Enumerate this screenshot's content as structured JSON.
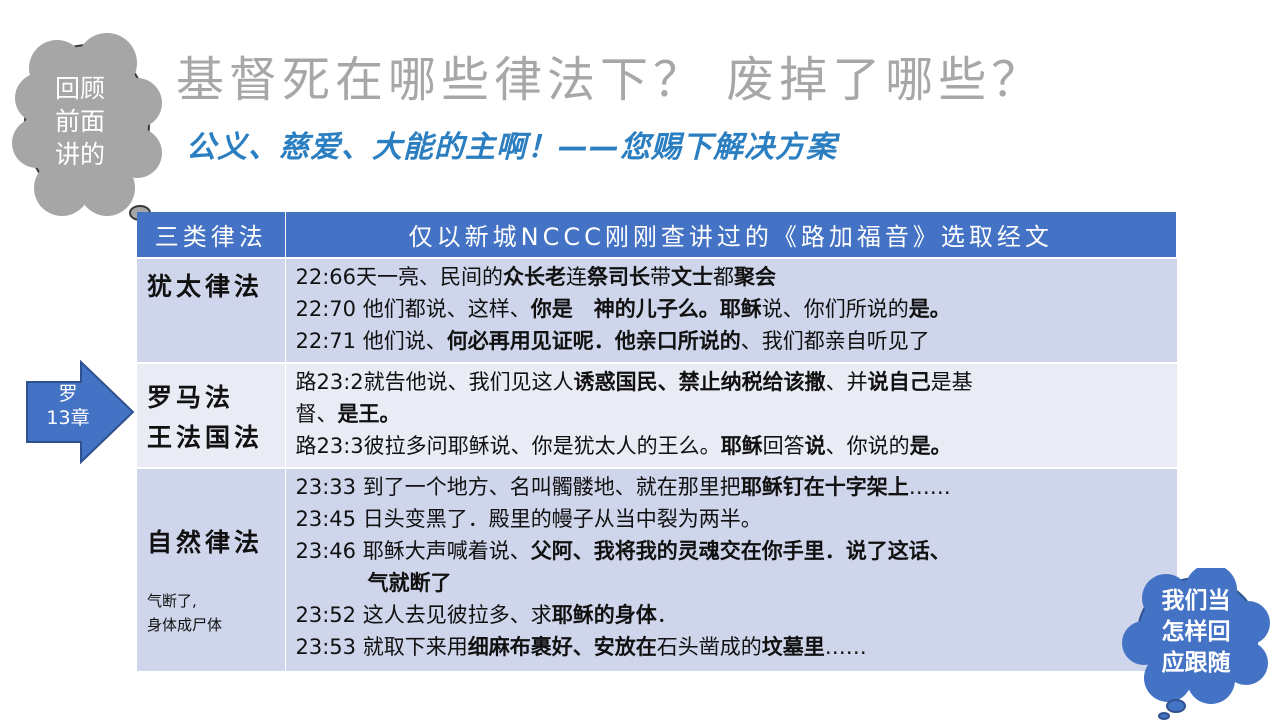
{
  "left_cloud": {
    "lines": [
      "回顾",
      "前面",
      "讲的"
    ]
  },
  "title": "基督死在哪些律法下？ 废掉了哪些？",
  "subtitle": "公义、慈爱、大能的主啊！——您赐下解决方案",
  "table": {
    "headers": [
      "三类律法",
      "仅以新城NCCC刚刚查讲过的《路加福音》选取经文"
    ],
    "rows": [
      {
        "category_lines": [
          "犹太律法"
        ],
        "note_lines": [],
        "verses": [
          [
            [
              "22:66天一亮、民间的",
              false
            ],
            [
              "众长老",
              true
            ],
            [
              "连",
              false
            ],
            [
              "祭司长",
              true
            ],
            [
              "带",
              false
            ],
            [
              "文士",
              true
            ],
            [
              "都",
              false
            ],
            [
              "聚会",
              true
            ]
          ],
          [
            [
              "22:70 他们都说、这样、",
              false
            ],
            [
              "你是　神的儿子么。耶稣",
              true
            ],
            [
              "说、你们所说的",
              false
            ],
            [
              "是。",
              true
            ]
          ],
          [
            [
              "22:71 他们说、",
              false
            ],
            [
              "何必再用见证呢．他亲口所说的",
              true
            ],
            [
              "、我们都亲自听见了",
              false
            ]
          ]
        ]
      },
      {
        "category_lines": [
          "罗马法",
          "王法国法"
        ],
        "note_lines": [],
        "verses": [
          [
            [
              "路23:2就告他说、我们见这人",
              false
            ],
            [
              "诱惑国民、禁止纳税给该撒",
              true
            ],
            [
              "、并",
              false
            ],
            [
              "说自己",
              true
            ],
            [
              "是基",
              false
            ]
          ],
          [
            [
              "督、",
              false
            ],
            [
              "是王。",
              true
            ]
          ],
          [
            [
              "路23:3彼拉多问耶稣说、你是犹太人的王么。",
              false
            ],
            [
              "耶稣",
              true
            ],
            [
              "回答",
              false
            ],
            [
              "说",
              true
            ],
            [
              "、你说的",
              false
            ],
            [
              "是。",
              true
            ]
          ]
        ]
      },
      {
        "category_lines": [
          "自然律法"
        ],
        "note_lines": [
          "气断了,",
          "身体成尸体"
        ],
        "verses": [
          [
            [
              "23:33 到了一个地方、名叫髑髅地、就在那里把",
              false
            ],
            [
              "耶稣钉在十字架上",
              true
            ],
            [
              "……",
              false
            ]
          ],
          [
            [
              "23:45 日头变黑了．殿里的幔子从当中裂为两半。",
              false
            ]
          ],
          [
            [
              "23:46 耶稣大声喊着说、",
              false
            ],
            [
              "父阿、我将我的灵魂交在你手里．说了这话、",
              true
            ]
          ],
          [
            [
              "气就断了",
              true
            ]
          ],
          [
            [
              "23:52 这人去见彼拉多、求",
              false
            ],
            [
              "耶稣的身体",
              true
            ],
            [
              "．",
              false
            ]
          ],
          [
            [
              "23:53 就取下来用",
              false
            ],
            [
              "细麻布裹好、安放在",
              true
            ],
            [
              "石头凿成的",
              false
            ],
            [
              "坟墓里",
              true
            ],
            [
              "……",
              false
            ]
          ]
        ]
      }
    ]
  },
  "arrow": {
    "lines": [
      "罗",
      "13章"
    ]
  },
  "right_cloud": {
    "lines": [
      "我们当",
      "怎样回",
      "应跟随"
    ]
  },
  "colors": {
    "header_bg": "#4472c4",
    "row_dark": "#cfd5ea",
    "row_light": "#e9ebf5",
    "cloud_gray": "#a6a6a6",
    "cloud_blue": "#4472c4",
    "subtitle": "#2b7fc1"
  }
}
